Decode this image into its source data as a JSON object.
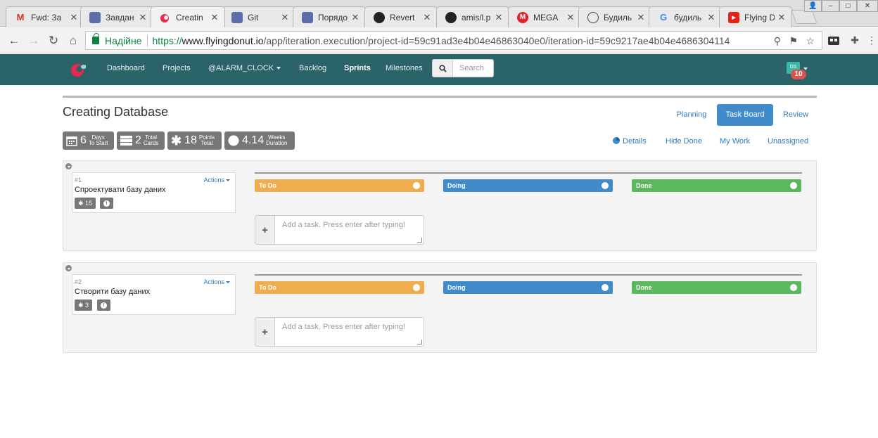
{
  "browser": {
    "tabs": [
      {
        "title": "Fwd: За",
        "icon": "gmail-icon",
        "active": false
      },
      {
        "title": "Завдан",
        "icon": "page-icon",
        "active": false
      },
      {
        "title": "Creatin",
        "icon": "flyingdonut-icon",
        "active": true
      },
      {
        "title": "Git",
        "icon": "page-icon",
        "active": false
      },
      {
        "title": "Порядо",
        "icon": "page-icon",
        "active": false
      },
      {
        "title": "Revert",
        "icon": "github-icon",
        "active": false
      },
      {
        "title": "amis/l.p",
        "icon": "github-icon",
        "active": false
      },
      {
        "title": "MEGA",
        "icon": "mega-icon",
        "active": false
      },
      {
        "title": "Будиль",
        "icon": "alarm-icon",
        "active": false
      },
      {
        "title": "будиль",
        "icon": "google-icon",
        "active": false
      },
      {
        "title": "Flying D",
        "icon": "youtube-icon",
        "active": false
      }
    ],
    "secure_label": "Надійне",
    "url_scheme": "https://",
    "url_host": "www.flyingdonut.io",
    "url_path": "/app/iteration.execution/project-id=59c91ad3e4b04e46863040e0/iteration-id=59c9217ae4b04e4686304114"
  },
  "nav": {
    "links": [
      "Dashboard",
      "Projects",
      "@ALARM_CLOCK",
      "Backlog",
      "Sprints",
      "Milestones"
    ],
    "search_placeholder": "Search",
    "avatar_initials": "DS",
    "notification_count": "10"
  },
  "page": {
    "title": "Creating Database",
    "view_tabs": [
      "Planning",
      "Task Board",
      "Review"
    ],
    "active_view": "Task Board",
    "stats": [
      {
        "value": "6",
        "label_top": "Days",
        "label_bottom": "To Start",
        "icon": "calendar-icon"
      },
      {
        "value": "2",
        "label_top": "Total",
        "label_bottom": "Cards",
        "icon": "cards-icon"
      },
      {
        "value": "18",
        "label_top": "Points",
        "label_bottom": "Total",
        "icon": "asterisk-icon"
      },
      {
        "value": "4.14",
        "label_top": "Weeks",
        "label_bottom": "Duration",
        "icon": "clock-icon"
      }
    ],
    "filters": [
      "Details",
      "Hide Done",
      "My Work",
      "Unassigned"
    ]
  },
  "stories": [
    {
      "number": "#1",
      "title": "Спроектувати базу даних",
      "points": "15",
      "actions_label": "Actions"
    },
    {
      "number": "#2",
      "title": "Створити базу даних",
      "points": "3",
      "actions_label": "Actions"
    }
  ],
  "columns": [
    "To Do",
    "Doing",
    "Done"
  ],
  "add_task_placeholder": "Add a task. Press enter after typing!",
  "colors": {
    "navbar": "#2a6468",
    "todo": "#f0ad4e",
    "doing": "#428bca",
    "done": "#5cb85c",
    "accent": "#428bca"
  }
}
